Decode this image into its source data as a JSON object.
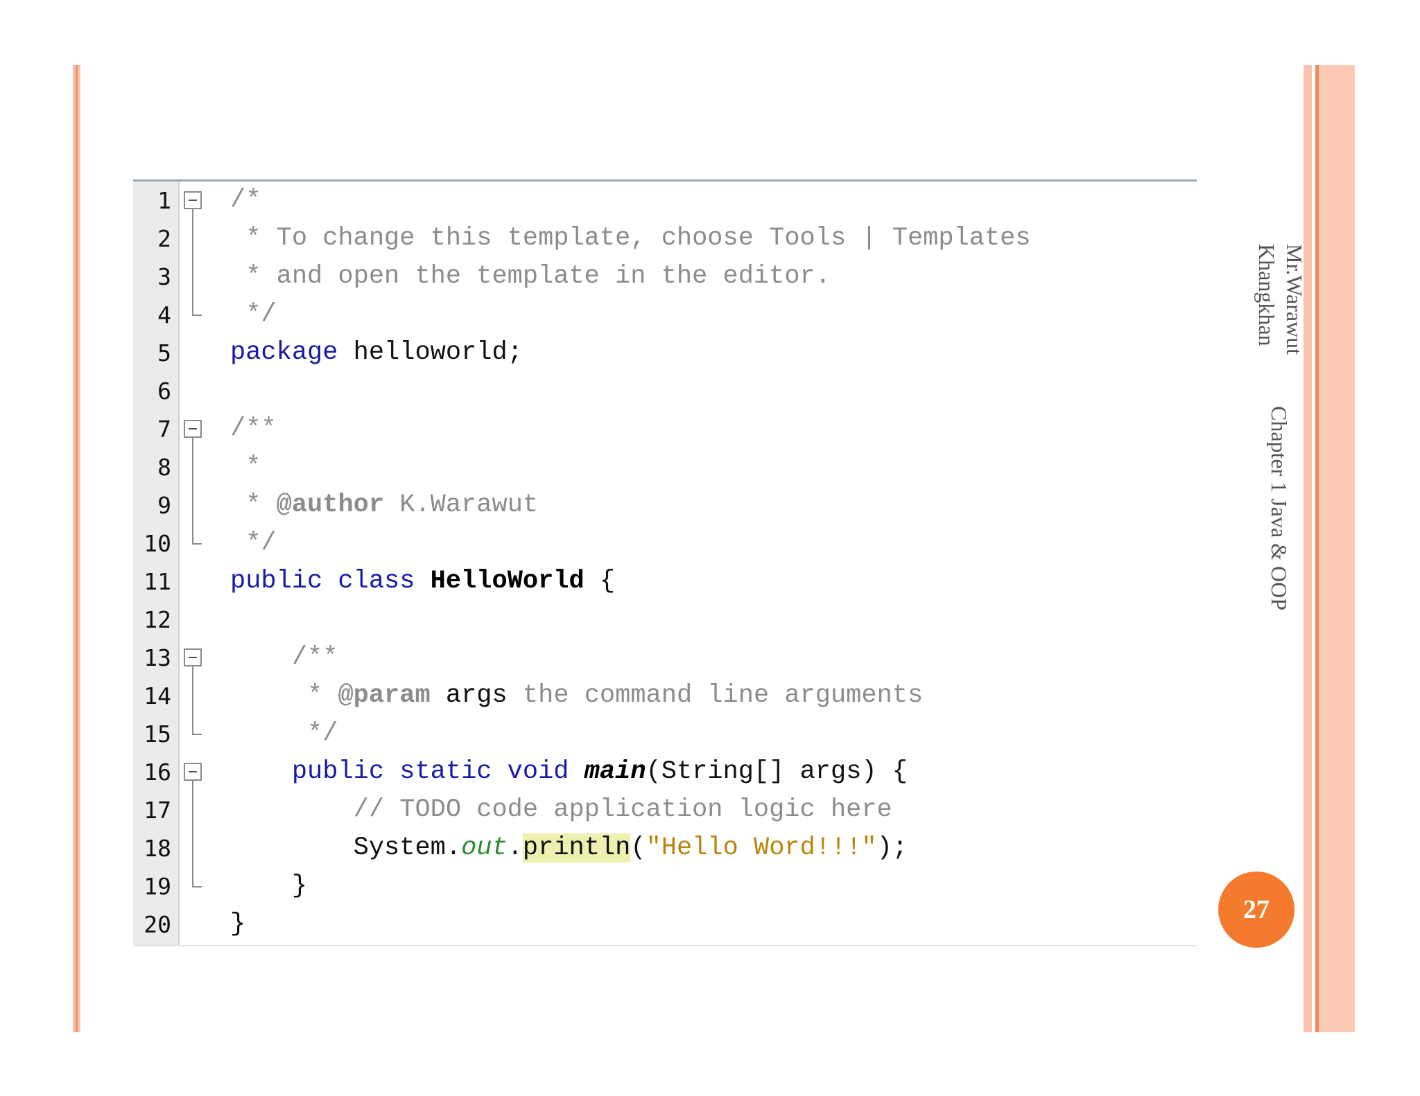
{
  "slide": {
    "page_number": "27",
    "author_line1": "Mr.Warawut",
    "author_line2": "Khangkhan",
    "chapter": "Chapter 1 Java & OOP"
  },
  "colors": {
    "accent_orange": "#f47a2e",
    "stripe_light": "#f9c3ad",
    "stripe_dark": "#f08a5d",
    "keyword": "#1a1aa6",
    "comment": "#8c8c8c",
    "string": "#b7860b",
    "field": "#2e8b2e",
    "highlight": "#eef0b0"
  },
  "editor": {
    "line_numbers": [
      "1",
      "2",
      "3",
      "4",
      "5",
      "6",
      "7",
      "8",
      "9",
      "10",
      "11",
      "12",
      "13",
      "14",
      "15",
      "16",
      "17",
      "18",
      "19",
      "20"
    ],
    "lines": {
      "l1": "/*",
      "l2": " * To change this template, choose Tools | Templates",
      "l3": " * and open the template in the editor.",
      "l4": " */",
      "l5_kw": "package",
      "l5_rest": " helloworld;",
      "l7": "/**",
      "l8": " *",
      "l9_a": " * ",
      "l9_tag": "@author",
      "l9_b": " K.Warawut",
      "l10": " */",
      "l11_kw": "public class",
      "l11_sp": " ",
      "l11_cls": "HelloWorld",
      "l11_end": " {",
      "l13": "    /**",
      "l14_a": "     * ",
      "l14_tag": "@param",
      "l14_arg": " args",
      "l14_b": " the command line arguments",
      "l15": "     */",
      "l16_indent": "    ",
      "l16_kw": "public static void",
      "l16_sp": " ",
      "l16_method": "main",
      "l16_rest": "(String[] args) {",
      "l17": "        // TODO code application logic here",
      "l18_a": "        System.",
      "l18_field": "out",
      "l18_dot": ".",
      "l18_hl": "println",
      "l18_open": "(",
      "l18_str": "\"Hello Word!!!\"",
      "l18_end": ");",
      "l19": "    }",
      "l20": "}"
    }
  }
}
